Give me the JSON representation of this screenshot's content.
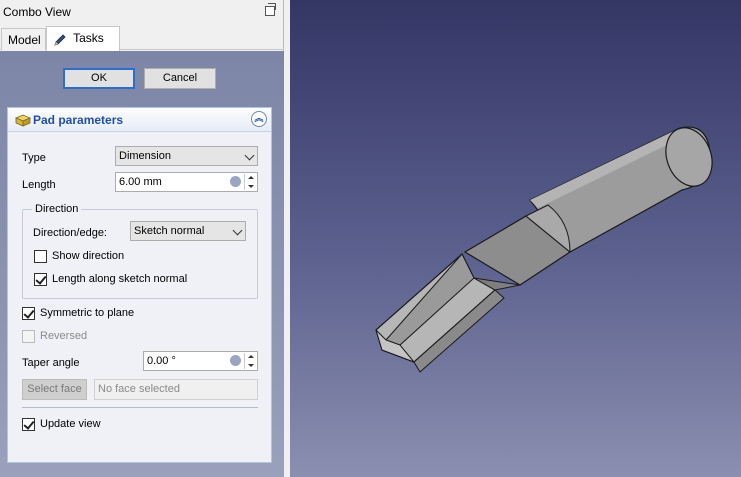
{
  "combo_view": {
    "title": "Combo View",
    "tabs": [
      {
        "label": "Model",
        "active": false
      },
      {
        "label": "Tasks",
        "active": true
      }
    ]
  },
  "dialog_buttons": {
    "ok": "OK",
    "cancel": "Cancel"
  },
  "pad_parameters": {
    "title": "Pad parameters",
    "type_label": "Type",
    "type_value": "Dimension",
    "length_label": "Length",
    "length_value": "6.00 mm",
    "direction": {
      "group_title": "Direction",
      "edge_label": "Direction/edge:",
      "edge_value": "Sketch normal",
      "show_direction_label": "Show direction",
      "show_direction_checked": false,
      "along_normal_label": "Length along sketch normal",
      "along_normal_checked": true
    },
    "symmetric_label": "Symmetric to plane",
    "symmetric_checked": true,
    "reversed_label": "Reversed",
    "reversed_checked": false,
    "taper_label": "Taper angle",
    "taper_value": "0.00 °",
    "select_face_label": "Select face",
    "face_placeholder": "No face selected",
    "update_view_label": "Update view",
    "update_view_checked": true
  },
  "viewport": {
    "background_top": "#343664",
    "background_bottom": "#8b8fb0",
    "model_color": "#a0a0a0"
  },
  "icons": {
    "float": "float-window-icon",
    "tasks_tab": "pencil-icon",
    "pad": "pad-icon",
    "collapse": "collapse-chevron-icon"
  }
}
